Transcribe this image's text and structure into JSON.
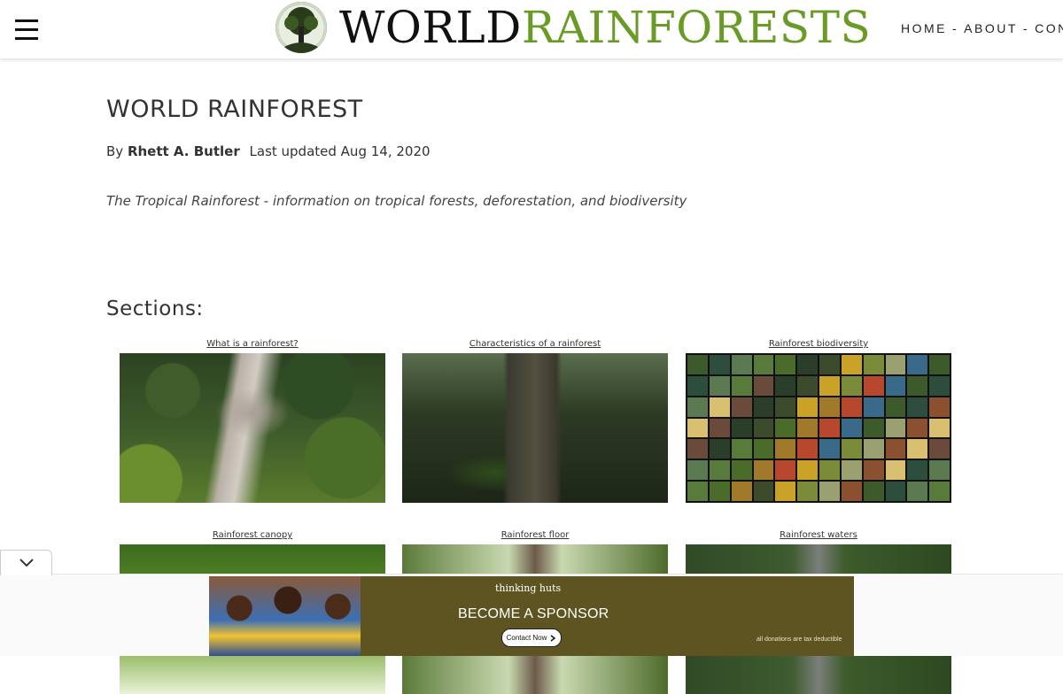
{
  "header": {
    "logo": {
      "word1": "WORLD",
      "word2": "RAINFORESTS"
    },
    "nav": [
      {
        "label": "HOME"
      },
      {
        "label": "ABOUT"
      },
      {
        "label": "CON"
      }
    ],
    "nav_separator": "-"
  },
  "article": {
    "title": "WORLD RAINFOREST",
    "by_prefix": "By",
    "author": "Rhett A. Butler",
    "updated": "Last updated Aug 14, 2020",
    "subtitle": "The Tropical Rainforest - information on tropical forests, deforestation, and biodiversity",
    "sections_heading": "Sections:"
  },
  "sections": [
    {
      "caption": "What is a rainforest?"
    },
    {
      "caption": "Characteristics of a rainforest"
    },
    {
      "caption": "Rainforest biodiversity"
    },
    {
      "caption": "Rainforest canopy"
    },
    {
      "caption": "Rainforest floor"
    },
    {
      "caption": "Rainforest waters"
    }
  ],
  "ad": {
    "brand": "thinking huts",
    "headline": "BECOME A SPONSOR",
    "button": "Contact Now",
    "note": "all donations are tax deductible"
  },
  "colors": {
    "logo_green": "#6a9b26",
    "ad_background": "#5e5421"
  },
  "icons": {
    "menu": "hamburger-icon",
    "collapse": "chevron-down-icon",
    "button_arrow": "chevron-right-icon"
  }
}
